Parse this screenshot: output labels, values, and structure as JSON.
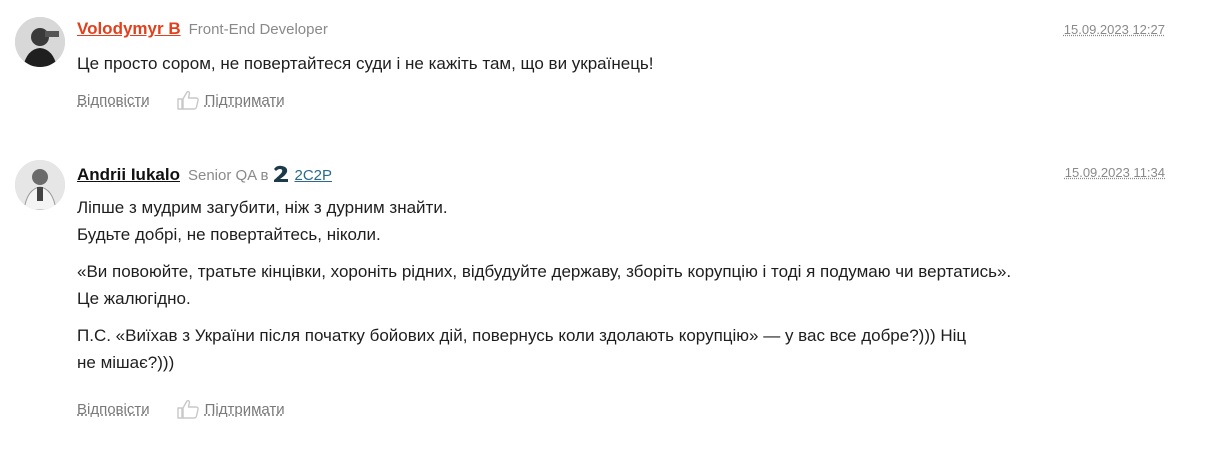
{
  "comments": [
    {
      "author": "Volodymyr B",
      "position": "Front-End Developer",
      "date": "15.09.2023 12:27",
      "lines": [
        "Це просто сором, не повертайтеся суди і не кажіть там, що ви українець!"
      ],
      "reply_label": "Відповісти",
      "support_label": "Підтримати"
    },
    {
      "author": "Andrii Iukalo",
      "position": "Senior QA в",
      "company": "2C2P",
      "date": "15.09.2023 11:34",
      "paragraphs": [
        [
          "Ліпше з мудрим загубити, ніж з дурним знайти.",
          "Будьте добрі, не повертайтесь, ніколи."
        ],
        [
          "«Ви повоюйте, тратьте кінцівки, хороніть рідних, відбудуйте державу, зборіть корупцію і тоді я подумаю чи вертатись».",
          "Це жалюгідно."
        ],
        [
          "П.С. «Виїхав з України після початку бойових дій, повернусь коли здолають корупцію» — у вас все добре?))) Ніц",
          "не мішає?)))"
        ]
      ],
      "reply_label": "Відповісти",
      "support_label": "Підтримати"
    }
  ],
  "colors": {
    "author_accent": "#e2401c",
    "company_link": "#2b6a8c",
    "muted": "#8a8a8a"
  },
  "icons": {
    "support": "thumbs-up-icon",
    "company": "company-logo-2c2p"
  }
}
